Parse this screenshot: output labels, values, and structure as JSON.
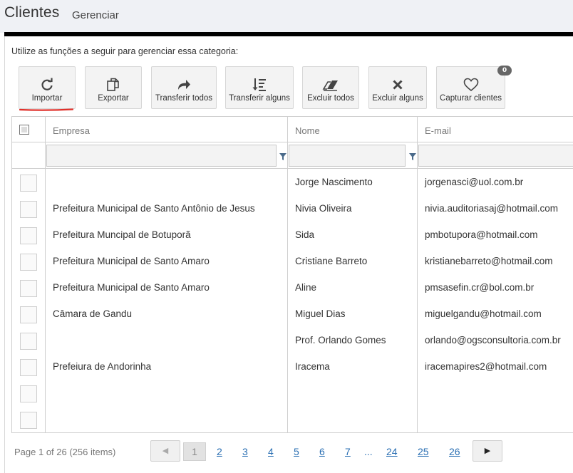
{
  "header": {
    "title": "Clientes",
    "subtitle": "Gerenciar"
  },
  "instructions": "Utilize as funções a seguir para gerenciar essa categoria:",
  "toolbar": [
    {
      "label": "Importar",
      "icon": "refresh-icon"
    },
    {
      "label": "Exportar",
      "icon": "copy-icon"
    },
    {
      "label": "Transferir todos",
      "icon": "share-arrow-icon"
    },
    {
      "label": "Transferir alguns",
      "icon": "sort-desc-icon"
    },
    {
      "label": "Excluir todos",
      "icon": "eraser-icon"
    },
    {
      "label": "Excluir alguns",
      "icon": "x-icon"
    },
    {
      "label": "Capturar clientes",
      "icon": "heart-icon",
      "badge": "0"
    }
  ],
  "accent_underline": "#e0302a",
  "grid": {
    "columns": [
      "Empresa",
      "Nome",
      "E-mail"
    ],
    "rows": [
      {
        "empresa": "",
        "nome": "Jorge Nascimento",
        "email": "jorgenasci@uol.com.br"
      },
      {
        "empresa": "Prefeitura Municipal de Santo Antônio de Jesus",
        "nome": "Nivia Oliveira",
        "email": "nivia.auditoriasaj@hotmail.com"
      },
      {
        "empresa": "Prefeitura Muncipal de Botuporã",
        "nome": "Sida",
        "email": "pmbotupora@hotmail.com"
      },
      {
        "empresa": "Prefeitura Municipal de Santo Amaro",
        "nome": "Cristiane Barreto",
        "email": "kristianebarreto@hotmail.com"
      },
      {
        "empresa": "Prefeitura Municipal de Santo Amaro",
        "nome": "Aline",
        "email": "pmsasefin.cr@bol.com.br"
      },
      {
        "empresa": "Câmara de Gandu",
        "nome": "Miguel Dias",
        "email": "miguelgandu@hotmail.com"
      },
      {
        "empresa": "",
        "nome": "Prof. Orlando Gomes",
        "email": "orlando@ogsconsultoria.com.br"
      },
      {
        "empresa": "Prefeiura de Andorinha",
        "nome": "Iracema",
        "email": "iracemapires2@hotmail.com"
      },
      {
        "empresa": "",
        "nome": "",
        "email": ""
      },
      {
        "empresa": "",
        "nome": "",
        "email": ""
      }
    ]
  },
  "pager": {
    "info": "Page 1 of 26 (256 items)",
    "current": "1",
    "pages": [
      "2",
      "3",
      "4",
      "5",
      "6",
      "7"
    ],
    "ellipsis": "...",
    "tail_pages": [
      "24",
      "25",
      "26"
    ]
  }
}
